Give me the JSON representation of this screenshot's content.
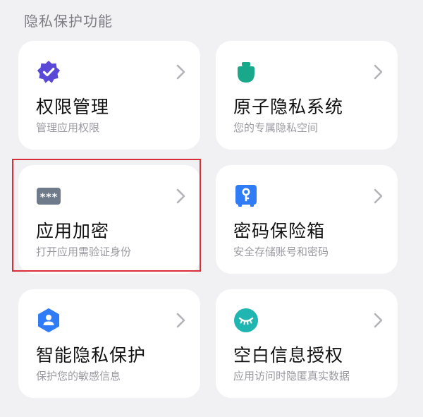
{
  "section_title": "隐私保护功能",
  "cards": [
    {
      "title": "权限管理",
      "subtitle": "管理应用权限",
      "icon": "verified-badge-icon",
      "icon_color": "#5a49d6"
    },
    {
      "title": "原子隐私系统",
      "subtitle": "您的专属隐私空间",
      "icon": "privacy-space-icon",
      "icon_color": "#1aa88a"
    },
    {
      "title": "应用加密",
      "subtitle": "打开应用需验证身份",
      "icon": "password-icon",
      "icon_color": "#6f7a8a",
      "icon_text": "***",
      "highlighted": true
    },
    {
      "title": "密码保险箱",
      "subtitle": "安全存储账号和密码",
      "icon": "key-safe-icon",
      "icon_color": "#2f7cf6"
    },
    {
      "title": "智能隐私保护",
      "subtitle": "保护您的敏感信息",
      "icon": "user-shield-icon",
      "icon_color": "#2f7cf6"
    },
    {
      "title": "空白信息授权",
      "subtitle": "应用访问时隐匿真实数据",
      "icon": "closed-eye-icon",
      "icon_color": "#1fb5b0"
    }
  ],
  "highlight_color": "#d8303a"
}
